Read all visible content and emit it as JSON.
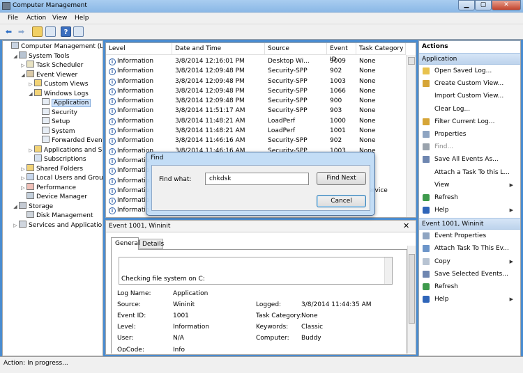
{
  "window": {
    "title": "Computer Management"
  },
  "menu": [
    "File",
    "Action",
    "View",
    "Help"
  ],
  "toolbar_icons": [
    "back-icon",
    "forward-icon",
    "up-folder-icon",
    "show-hide-tree-icon",
    "help-icon",
    "properties-icon"
  ],
  "tree": [
    {
      "label": "Computer Management (Local",
      "level": 0,
      "exp": "",
      "icon": "computer-icon"
    },
    {
      "label": "System Tools",
      "level": 1,
      "exp": "◢",
      "icon": "tools-icon"
    },
    {
      "label": "Task Scheduler",
      "level": 2,
      "exp": "▷",
      "icon": "clock-icon"
    },
    {
      "label": "Event Viewer",
      "level": 2,
      "exp": "◢",
      "icon": "event-viewer-icon"
    },
    {
      "label": "Custom Views",
      "level": 3,
      "exp": "▷",
      "icon": "folder-icon"
    },
    {
      "label": "Windows Logs",
      "level": 3,
      "exp": "◢",
      "icon": "folder-icon"
    },
    {
      "label": "Application",
      "level": 4,
      "exp": "",
      "icon": "log-icon",
      "selected": true
    },
    {
      "label": "Security",
      "level": 4,
      "exp": "",
      "icon": "log-icon"
    },
    {
      "label": "Setup",
      "level": 4,
      "exp": "",
      "icon": "log-icon"
    },
    {
      "label": "System",
      "level": 4,
      "exp": "",
      "icon": "log-icon"
    },
    {
      "label": "Forwarded Event",
      "level": 4,
      "exp": "",
      "icon": "log-icon"
    },
    {
      "label": "Applications and Se",
      "level": 3,
      "exp": "▷",
      "icon": "folder-icon"
    },
    {
      "label": "Subscriptions",
      "level": 3,
      "exp": "",
      "icon": "subscriptions-icon"
    },
    {
      "label": "Shared Folders",
      "level": 2,
      "exp": "▷",
      "icon": "shared-folder-icon"
    },
    {
      "label": "Local Users and Groups",
      "level": 2,
      "exp": "▷",
      "icon": "users-icon"
    },
    {
      "label": "Performance",
      "level": 2,
      "exp": "▷",
      "icon": "performance-icon"
    },
    {
      "label": "Device Manager",
      "level": 2,
      "exp": "",
      "icon": "device-manager-icon"
    },
    {
      "label": "Storage",
      "level": 1,
      "exp": "◢",
      "icon": "storage-icon"
    },
    {
      "label": "Disk Management",
      "level": 2,
      "exp": "",
      "icon": "disk-icon"
    },
    {
      "label": "Services and Applications",
      "level": 1,
      "exp": "▷",
      "icon": "services-icon"
    }
  ],
  "events": {
    "columns": [
      "Level",
      "Date and Time",
      "Source",
      "Event ID",
      "Task Category"
    ],
    "rows": [
      [
        "Information",
        "3/8/2014 12:16:01 PM",
        "Desktop Wi...",
        "9009",
        "None"
      ],
      [
        "Information",
        "3/8/2014 12:09:48 PM",
        "Security-SPP",
        "902",
        "None"
      ],
      [
        "Information",
        "3/8/2014 12:09:48 PM",
        "Security-SPP",
        "1003",
        "None"
      ],
      [
        "Information",
        "3/8/2014 12:09:48 PM",
        "Security-SPP",
        "1066",
        "None"
      ],
      [
        "Information",
        "3/8/2014 12:09:48 PM",
        "Security-SPP",
        "900",
        "None"
      ],
      [
        "Information",
        "3/8/2014 11:51:17 AM",
        "Security-SPP",
        "903",
        "None"
      ],
      [
        "Information",
        "3/8/2014 11:48:21 AM",
        "LoadPerf",
        "1000",
        "None"
      ],
      [
        "Information",
        "3/8/2014 11:48:21 AM",
        "LoadPerf",
        "1001",
        "None"
      ],
      [
        "Information",
        "3/8/2014 11:46:16 AM",
        "Security-SPP",
        "902",
        "None"
      ],
      [
        "Information",
        "3/8/2014 11:46:16 AM",
        "Security-SPP",
        "1003",
        "None"
      ],
      [
        "Informatio",
        "",
        "",
        "",
        ""
      ],
      [
        "Informatio",
        "",
        "",
        "",
        ""
      ],
      [
        "Informatio",
        "",
        "",
        "",
        ""
      ],
      [
        "Informatio",
        "",
        "",
        "",
        "n service"
      ],
      [
        "Informatio",
        "",
        "",
        "",
        ""
      ],
      [
        "Informatio",
        "",
        "",
        "",
        ""
      ]
    ]
  },
  "detail": {
    "title": "Event 1001, Wininit",
    "tabs": [
      "General",
      "Details"
    ],
    "message": "Checking file system on C:",
    "fields": {
      "log_name_label": "Log Name:",
      "log_name": "Application",
      "source_label": "Source:",
      "source": "Wininit",
      "event_id_label": "Event ID:",
      "event_id": "1001",
      "level_label": "Level:",
      "level": "Information",
      "user_label": "User:",
      "user": "N/A",
      "opcode_label": "OpCode:",
      "opcode": "Info",
      "logged_label": "Logged:",
      "logged": "3/8/2014 11:44:35 AM",
      "task_cat_label": "Task Category:",
      "task_cat": "None",
      "keywords_label": "Keywords:",
      "keywords": "Classic",
      "computer_label": "Computer:",
      "computer": "Buddy"
    }
  },
  "actions": {
    "header": "Actions",
    "section1": "Application",
    "items1": [
      {
        "label": "Open Saved Log...",
        "icon": "open-log-icon"
      },
      {
        "label": "Create Custom View...",
        "icon": "filter-icon"
      },
      {
        "label": "Import Custom View...",
        "icon": ""
      },
      {
        "label": "Clear Log...",
        "icon": ""
      },
      {
        "label": "Filter Current Log...",
        "icon": "filter-icon"
      },
      {
        "label": "Properties",
        "icon": "properties-icon"
      },
      {
        "label": "Find...",
        "icon": "binoculars-icon",
        "disabled": true
      },
      {
        "label": "Save All Events As...",
        "icon": "save-icon"
      },
      {
        "label": "Attach a Task To this L...",
        "icon": ""
      },
      {
        "label": "View",
        "icon": "",
        "arrow": true
      },
      {
        "label": "Refresh",
        "icon": "refresh-icon"
      },
      {
        "label": "Help",
        "icon": "help-icon",
        "arrow": true
      }
    ],
    "section2": "Event 1001, Wininit",
    "items2": [
      {
        "label": "Event Properties",
        "icon": "event-properties-icon"
      },
      {
        "label": "Attach Task To This Ev...",
        "icon": "attach-task-icon"
      },
      {
        "label": "Copy",
        "icon": "copy-icon",
        "arrow": true
      },
      {
        "label": "Save Selected Events...",
        "icon": "save-icon"
      },
      {
        "label": "Refresh",
        "icon": "refresh-icon"
      },
      {
        "label": "Help",
        "icon": "help-icon",
        "arrow": true
      }
    ]
  },
  "find_dialog": {
    "title": "Find",
    "find_what_label": "Find what:",
    "find_what_value": "chkdsk",
    "find_next": "Find Next",
    "cancel": "Cancel"
  },
  "status": {
    "text": "Action:  In progress..."
  },
  "colors": {
    "accent": "#3b78c2",
    "selection": "#cfe3fb",
    "title_bar": "#a9cdf0"
  }
}
